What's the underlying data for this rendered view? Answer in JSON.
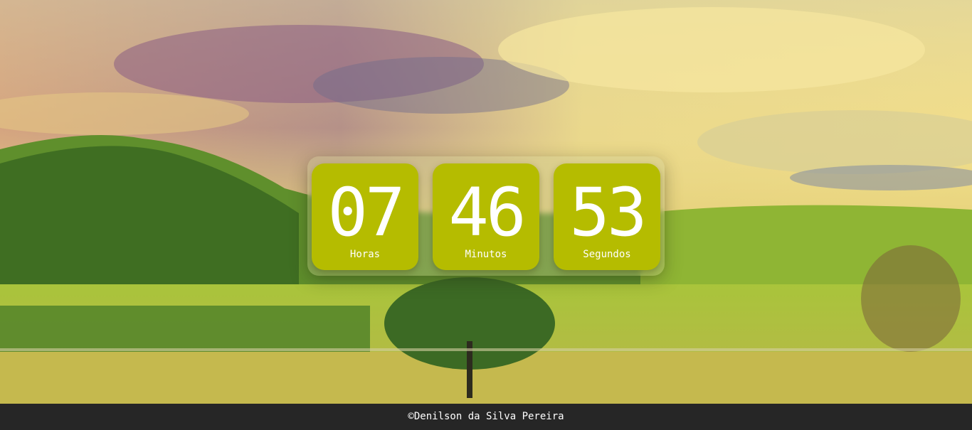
{
  "clock": {
    "hours": "07",
    "hours_label": "Horas",
    "minutes": "46",
    "minutes_label": "Minutos",
    "seconds": "53",
    "seconds_label": "Segundos"
  },
  "footer": {
    "text": "©Denilson da Silva Pereira"
  },
  "colors": {
    "tile": "#b5bc00",
    "footer_bg": "#262626",
    "text": "#ffffff"
  }
}
